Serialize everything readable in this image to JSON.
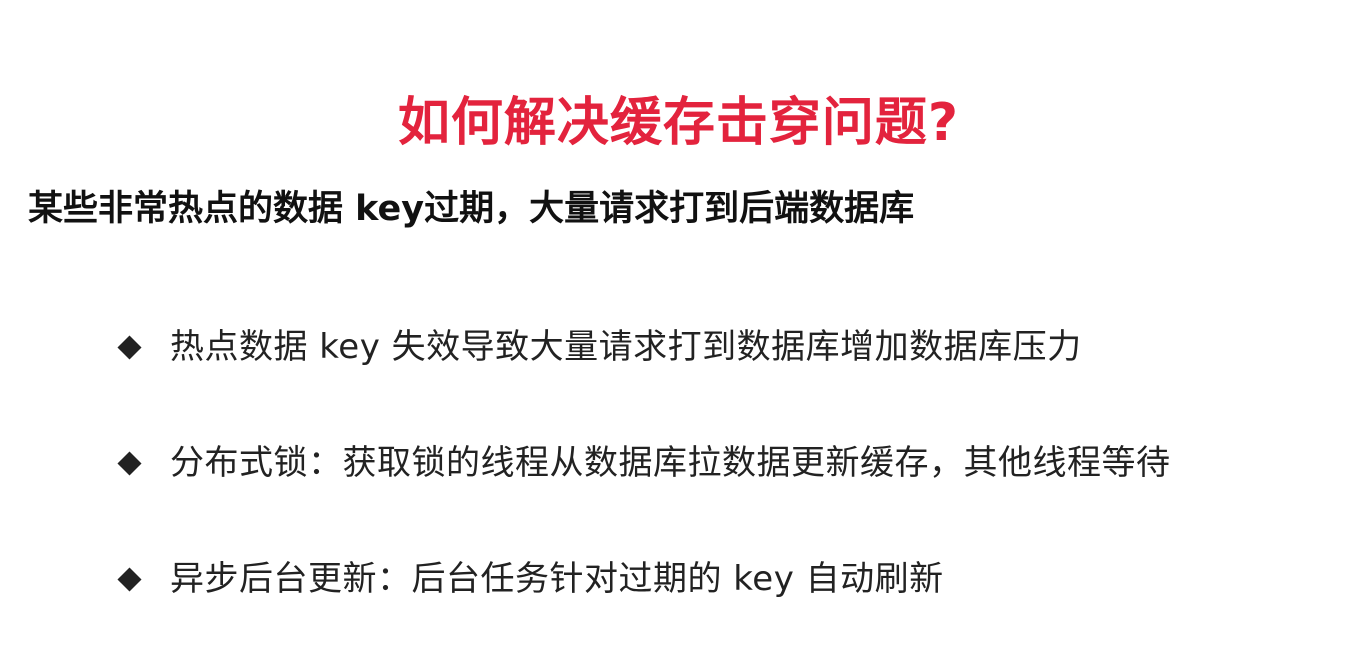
{
  "title": "如何解决缓存击穿问题?",
  "subtitle": "某些非常热点的数据 key过期，大量请求打到后端数据库",
  "bullets": [
    "热点数据 key 失效导致大量请求打到数据库增加数据库压力",
    "分布式锁：获取锁的线程从数据库拉数据更新缓存，其他线程等待",
    "异步后台更新：后台任务针对过期的 key 自动刷新"
  ],
  "colors": {
    "title": "#e3233d",
    "text": "#222222",
    "background": "#ffffff"
  },
  "icons": {
    "bullet": "diamond-bullet-icon"
  }
}
